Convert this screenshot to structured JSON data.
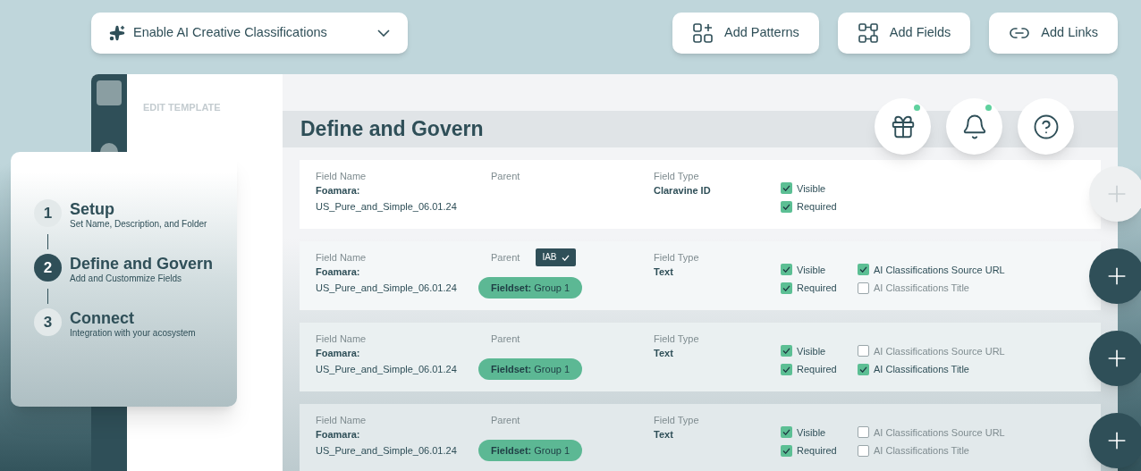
{
  "toolbar": {
    "ai_toggle": {
      "label": "Enable AI Creative Classifications"
    },
    "actions": [
      {
        "kind": "patterns",
        "label": "Add Patterns"
      },
      {
        "kind": "fields",
        "label": "Add Fields"
      },
      {
        "kind": "links",
        "label": "Add Links"
      }
    ]
  },
  "panel": {
    "sidebar_label": "EDIT TEMPLATE",
    "title": "Define and Govern",
    "header_actions": [
      {
        "kind": "gift",
        "badge": true
      },
      {
        "kind": "bell",
        "badge": true
      },
      {
        "kind": "help",
        "badge": false
      }
    ],
    "rows": [
      {
        "name_label": "Field Name",
        "name_prefix": "Foamara:",
        "name": "US_Pure_and_Simple_06.01.24",
        "parent_label": "Parent",
        "type_label": "Field Type",
        "type": "Claravine ID",
        "options": [
          {
            "label": "Visible",
            "checked": true
          },
          {
            "label": "Required",
            "checked": true
          }
        ]
      },
      {
        "name_label": "Field Name",
        "name_prefix": "Foamara:",
        "name": "US_Pure_and_Simple_06.01.24",
        "parent_label": "Parent",
        "tag": {
          "label": "IAB",
          "checked": true
        },
        "parent": "**Fieldset:** Group 1",
        "type_label": "Field Type",
        "type": "Text",
        "options": [
          {
            "label": "Visible",
            "checked": true
          },
          {
            "label": "Required",
            "checked": true
          },
          {
            "label": "AI Classifications Source URL",
            "checked": true
          },
          {
            "label": "AI Classifications Title",
            "checked": false
          }
        ]
      },
      {
        "name_label": "Field Name",
        "name_prefix": "Foamara:",
        "name": "US_Pure_and_Simple_06.01.24",
        "parent_label": "Parent",
        "parent": "**Fieldset:** Group 1",
        "type_label": "Field Type",
        "type": "Text",
        "options": [
          {
            "label": "Visible",
            "checked": true
          },
          {
            "label": "Required",
            "checked": true
          },
          {
            "label": "AI Classifications Source URL",
            "checked": false
          },
          {
            "label": "AI Classifications Title",
            "checked": true
          }
        ]
      },
      {
        "name_label": "Field Name",
        "name_prefix": "Foamara:",
        "name": "US_Pure_and_Simple_06.01.24",
        "parent_label": "Parent",
        "parent": "**Fieldset:** Group 1",
        "type_label": "Field Type",
        "type": "Text",
        "options": [
          {
            "label": "Visible",
            "checked": true
          },
          {
            "label": "Required",
            "checked": true
          },
          {
            "label": "AI Classifications Source URL",
            "checked": false
          },
          {
            "label": "AI Classifications Title",
            "checked": false
          }
        ]
      }
    ],
    "add_buttons": [
      {
        "disabled": true
      },
      {
        "disabled": false
      },
      {
        "disabled": false
      },
      {
        "disabled": false
      }
    ]
  },
  "steps": [
    {
      "number": "1",
      "title": "Setup",
      "subtitle": "Set Name, Description, and Folder",
      "selected": false
    },
    {
      "number": "2",
      "title": "Define and Govern",
      "subtitle": "Add and Custommize Fields",
      "selected": true
    },
    {
      "number": "3",
      "title": "Connect",
      "subtitle": "Integration with your acosystem",
      "selected": false
    }
  ]
}
